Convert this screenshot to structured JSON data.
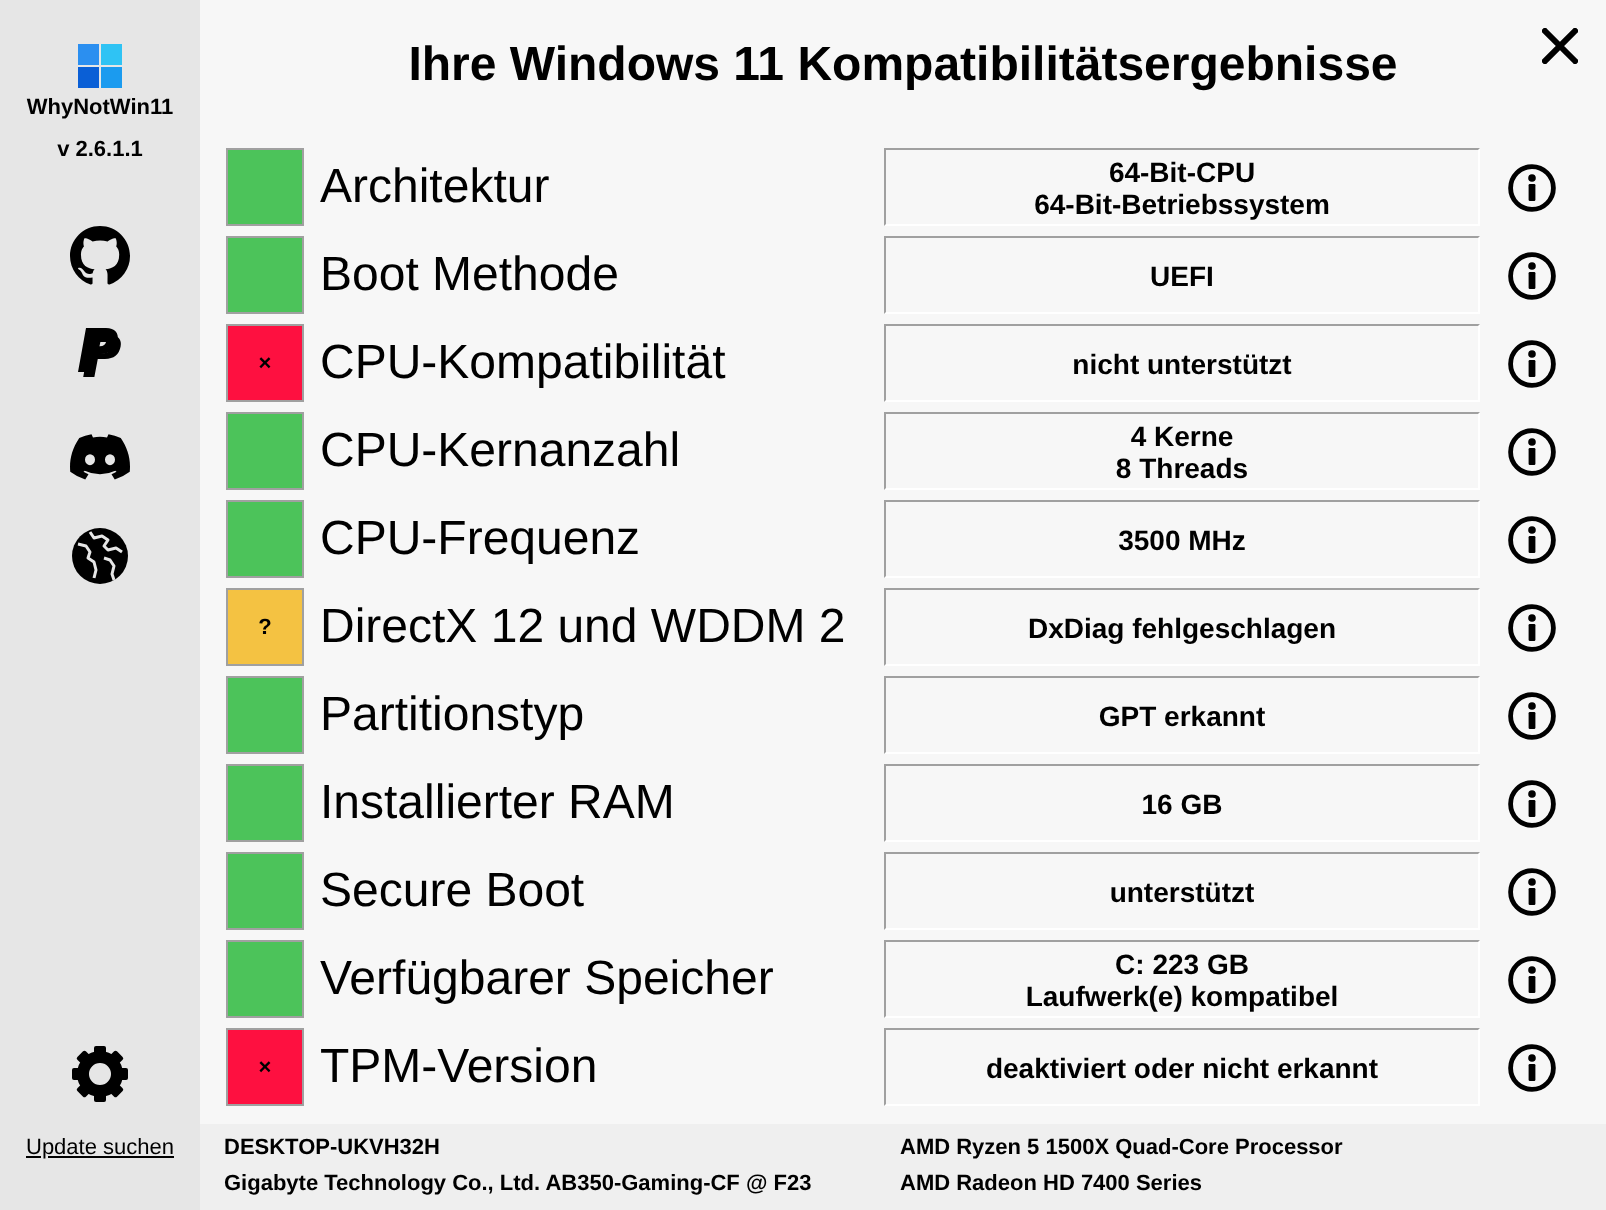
{
  "window": {
    "title": "Ihre Windows 11 Kompatibilitätsergebnisse"
  },
  "sidebar": {
    "app_name": "WhyNotWin11",
    "version": "v 2.6.1.1",
    "update_link": "Update suchen"
  },
  "checks": [
    {
      "label": "Architektur",
      "color": "#4cc35a",
      "value": [
        "64-Bit-CPU",
        "64-Bit-Betriebssystem"
      ]
    },
    {
      "label": "Boot Methode",
      "color": "#4cc35a",
      "value": [
        "UEFI"
      ]
    },
    {
      "label": "CPU-Kompatibilität",
      "color": "#fe1040",
      "symbol": "×",
      "value": [
        "nicht unterstützt"
      ]
    },
    {
      "label": "CPU-Kernanzahl",
      "color": "#4cc35a",
      "value": [
        "4 Kerne",
        "8 Threads"
      ]
    },
    {
      "label": "CPU-Frequenz",
      "color": "#4cc35a",
      "value": [
        "3500 MHz"
      ]
    },
    {
      "label": "DirectX 12 und WDDM 2",
      "color": "#f4c242",
      "symbol": "?",
      "value": [
        "DxDiag fehlgeschlagen"
      ]
    },
    {
      "label": "Partitionstyp",
      "color": "#4cc35a",
      "value": [
        "GPT erkannt"
      ]
    },
    {
      "label": "Installierter RAM",
      "color": "#4cc35a",
      "value": [
        "16 GB"
      ]
    },
    {
      "label": "Secure Boot",
      "color": "#4cc35a",
      "value": [
        "unterstützt"
      ]
    },
    {
      "label": "Verfügbarer Speicher",
      "color": "#4cc35a",
      "value": [
        "C: 223 GB",
        "Laufwerk(e) kompatibel"
      ]
    },
    {
      "label": "TPM-Version",
      "color": "#fe1040",
      "symbol": "×",
      "value": [
        "deaktiviert oder nicht erkannt"
      ]
    }
  ],
  "footer": {
    "computer_name": "DESKTOP-UKVH32H",
    "motherboard": "Gigabyte Technology Co., Ltd. AB350-Gaming-CF @ F23",
    "cpu": "AMD Ryzen 5 1500X Quad-Core Processor",
    "gpu": "AMD Radeon HD 7400 Series"
  }
}
